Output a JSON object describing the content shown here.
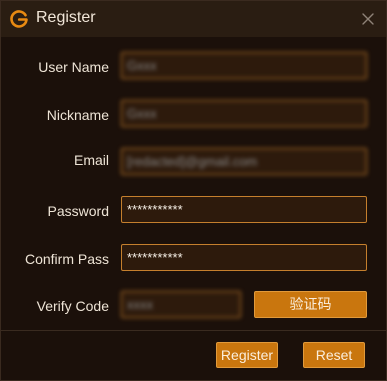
{
  "window": {
    "title": "Register",
    "brand_color": "#e88a12",
    "accent_color": "#c9760e",
    "background_color": "#1b100a",
    "logo_icon": "logo-g-icon",
    "close_icon": "close-icon"
  },
  "form": {
    "user_name": {
      "label": "User Name",
      "value": "Gxxx"
    },
    "nickname": {
      "label": "Nickname",
      "value": "Gxxx"
    },
    "email": {
      "label": "Email",
      "value": "[redacted]@gmail.com"
    },
    "password": {
      "label": "Password",
      "value": "***********"
    },
    "confirm_password": {
      "label": "Confirm Pass",
      "value": "***********"
    },
    "verify_code": {
      "label": "Verify Code",
      "value": "xxxx",
      "button_label": "验证码"
    }
  },
  "footer": {
    "register_label": "Register",
    "reset_label": "Reset"
  }
}
